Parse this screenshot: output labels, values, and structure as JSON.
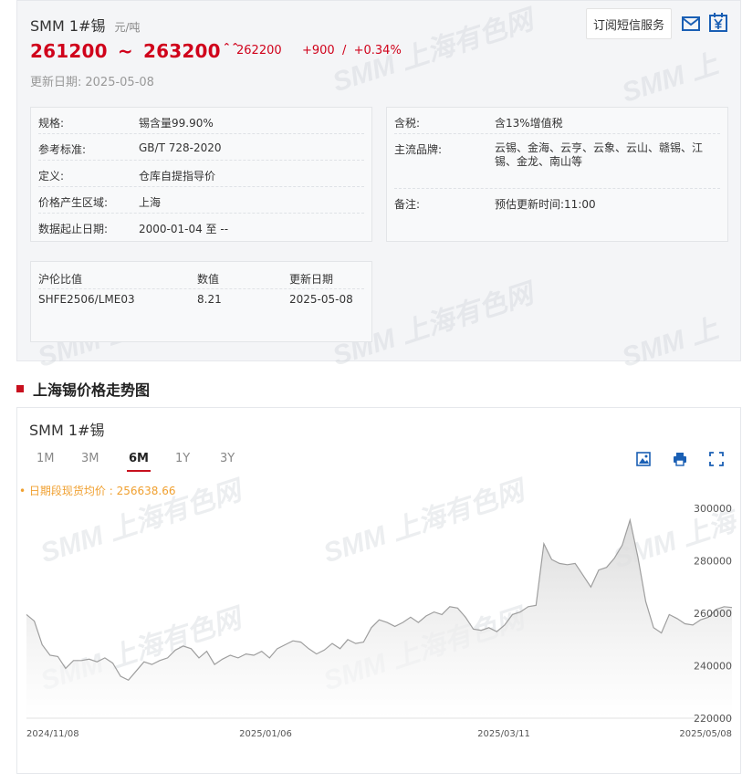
{
  "product": {
    "name": "SMM 1#锡",
    "unit": "元/吨",
    "price_low": "261200",
    "tilde": "~",
    "price_high": "263200",
    "avg_price": "262200",
    "change": "+900  /  +0.34%",
    "update_label": "更新日期:",
    "update_date": "2025-05-08",
    "sms_label": "订阅短信服务"
  },
  "specs_left": [
    {
      "key": "规格:",
      "value": "锡含量99.90%"
    },
    {
      "key": "参考标准:",
      "value": "GB/T 728-2020"
    },
    {
      "key": "定义:",
      "value": "仓库自提指导价"
    },
    {
      "key": "价格产生区域:",
      "value": "上海"
    },
    {
      "key": "数据起止日期:",
      "value": "2000-01-04 至 --"
    }
  ],
  "specs_right": [
    {
      "key": "含税:",
      "value": "含13%增值税"
    },
    {
      "key": "主流品牌:",
      "value": "云锡、金海、云亨、云象、云山、赣锡、江锡、金龙、南山等"
    },
    {
      "key": "备注:",
      "value": "预估更新时间:11:00"
    }
  ],
  "ratio_table": {
    "headers": [
      "沪伦比值",
      "数值",
      "更新日期"
    ],
    "rows": [
      [
        "SHFE2506/LME03",
        "8.21",
        "2025-05-08"
      ]
    ]
  },
  "section_title": "上海锡价格走势图",
  "chart_panel": {
    "name": "SMM 1#锡",
    "tabs": [
      {
        "label": "1M",
        "active": false
      },
      {
        "label": "3M",
        "active": false
      },
      {
        "label": "6M",
        "active": true
      },
      {
        "label": "1Y",
        "active": false
      },
      {
        "label": "3Y",
        "active": false
      }
    ],
    "avg_line": "• 日期段现货均价 : 256638.66",
    "tools": [
      "download-icon",
      "print-icon",
      "fullscreen-icon"
    ]
  },
  "watermark_text": "SMM 上海有色网",
  "colors": {
    "price_red": "#d0021b",
    "accent_red": "#c8101e",
    "line_gray": "#9e9e9e",
    "avg_orange": "#f0a030"
  },
  "chart_data": {
    "type": "area",
    "x_labels": [
      "2024/11/08",
      "2025/01/06",
      "2025/03/11",
      "2025/05/08"
    ],
    "yticks": [
      220000,
      240000,
      260000,
      280000,
      300000
    ],
    "ylim": [
      220000,
      300000
    ],
    "values": [
      259500,
      257000,
      248000,
      244000,
      243500,
      239000,
      242000,
      242000,
      242500,
      241500,
      243000,
      241000,
      236000,
      234500,
      238000,
      241500,
      240500,
      242000,
      243000,
      246000,
      247500,
      246500,
      243000,
      245500,
      240500,
      242500,
      244000,
      243000,
      244500,
      244000,
      245500,
      243000,
      246500,
      248000,
      249500,
      249000,
      246500,
      244500,
      246000,
      248500,
      246500,
      250000,
      248500,
      249000,
      254500,
      257500,
      256500,
      255000,
      256500,
      258500,
      256500,
      259000,
      260500,
      259500,
      262500,
      262000,
      258500,
      254000,
      253500,
      254500,
      253000,
      255500,
      259500,
      260500,
      262500,
      263000,
      286500,
      280500,
      279000,
      278500,
      279000,
      274500,
      270000,
      276500,
      277500,
      281000,
      286000,
      295500,
      281500,
      264500,
      254500,
      252500,
      259500,
      258000,
      256000,
      255500,
      257500,
      258500,
      261500,
      262500,
      262200
    ],
    "series_color": "#9e9e9e",
    "grid": false
  }
}
